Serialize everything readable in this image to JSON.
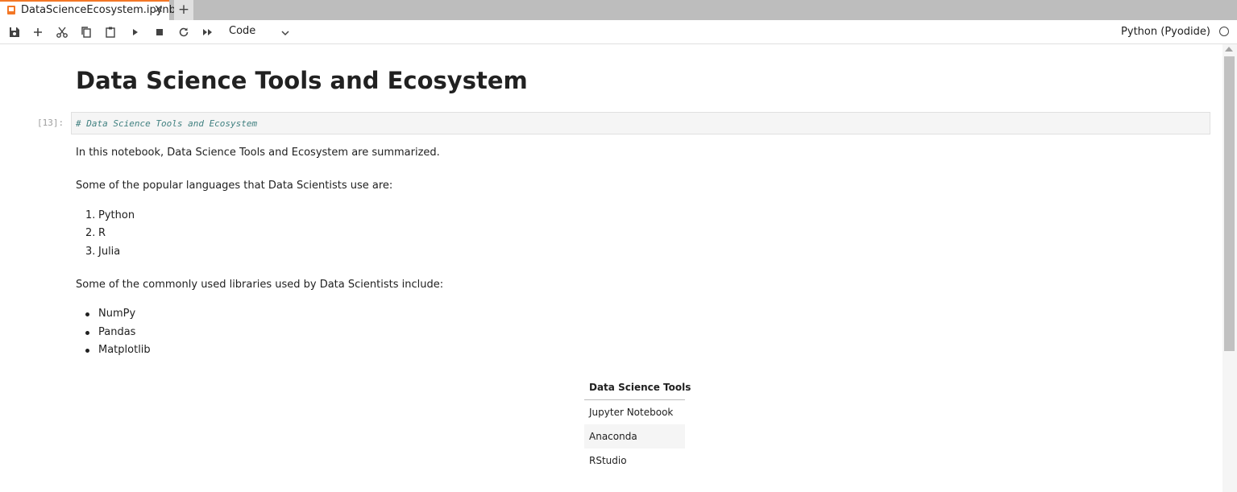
{
  "tab": {
    "title": "DataScienceEcosystem.ipynb",
    "close": "✕",
    "add": "+"
  },
  "toolbar": {
    "cell_type": "Code",
    "kernel_name": "Python (Pyodide)",
    "icons": [
      "save-icon",
      "add-cell-icon",
      "cut-icon",
      "copy-icon",
      "paste-icon",
      "run-icon",
      "stop-icon",
      "restart-icon",
      "run-all-icon"
    ]
  },
  "notebook": {
    "heading": "Data Science Tools and Ecosystem",
    "code_cell": {
      "prompt": "[13]:",
      "source": "# Data Science Tools and Ecosystem"
    },
    "intro": "In this notebook, Data Science Tools and Ecosystem are summarized.",
    "languages_intro": "Some of the popular languages that Data Scientists use are:",
    "languages": [
      {
        "num": "1.",
        "name": "Python"
      },
      {
        "num": "2.",
        "name": "R"
      },
      {
        "num": "3.",
        "name": "Julia"
      }
    ],
    "libraries_intro": "Some of the commonly used libraries used by Data Scientists include:",
    "libraries": [
      "NumPy",
      "Pandas",
      "Matplotlib"
    ],
    "table": {
      "header": "Data Science Tools",
      "rows": [
        "Jupyter Notebook",
        "Anaconda",
        "RStudio"
      ]
    }
  }
}
